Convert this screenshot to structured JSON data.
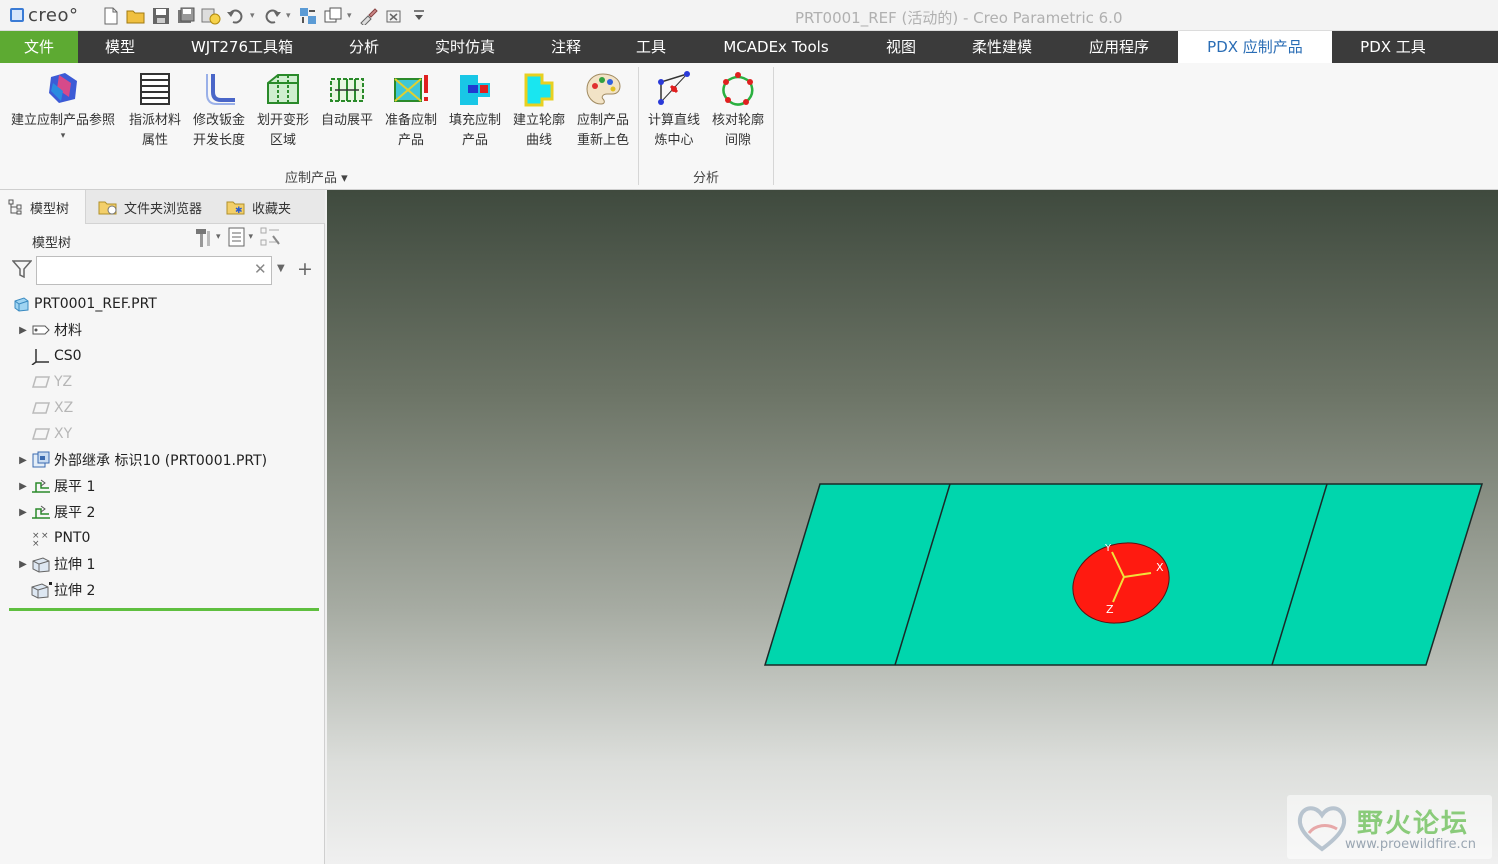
{
  "app": {
    "logo_text": "creo°",
    "window_title": "PRT0001_REF (活动的) - Creo Parametric 6.0"
  },
  "quick_access": [
    "new-icon",
    "open-icon",
    "save-icon",
    "save-copy-icon",
    "regenerate-icon",
    "undo-icon",
    "redo-icon",
    "switch-window-icon",
    "windows-icon",
    "close-window-icon",
    "customize-icon"
  ],
  "tabs": [
    {
      "label": "文件"
    },
    {
      "label": "模型"
    },
    {
      "label": "WJT276工具箱"
    },
    {
      "label": "分析"
    },
    {
      "label": "实时仿真"
    },
    {
      "label": "注释"
    },
    {
      "label": "工具"
    },
    {
      "label": "MCADEx Tools"
    },
    {
      "label": "视图"
    },
    {
      "label": "柔性建模"
    },
    {
      "label": "应用程序"
    },
    {
      "label": "PDX 应制产品"
    },
    {
      "label": "PDX 工具"
    }
  ],
  "ribbon": {
    "groups": [
      {
        "label": "应制产品 ▾"
      },
      {
        "label": "分析"
      }
    ],
    "buttons": [
      {
        "line1": "建立应制产品参照",
        "line2": ""
      },
      {
        "line1": "指派材料",
        "line2": "属性"
      },
      {
        "line1": "修改钣金",
        "line2": "开发长度"
      },
      {
        "line1": "划开变形",
        "line2": "区域"
      },
      {
        "line1": "自动展平",
        "line2": ""
      },
      {
        "line1": "准备应制",
        "line2": "产品"
      },
      {
        "line1": "填充应制",
        "line2": "产品"
      },
      {
        "line1": "建立轮廓",
        "line2": "曲线"
      },
      {
        "line1": "应制产品",
        "line2": "重新上色"
      },
      {
        "line1": "计算直线",
        "line2": "炼中心"
      },
      {
        "line1": "核对轮廓",
        "line2": "间隙"
      }
    ]
  },
  "panel": {
    "tabs": [
      {
        "label": "模型树"
      },
      {
        "label": "文件夹浏览器"
      },
      {
        "label": "收藏夹"
      }
    ],
    "tree_header": "模型树",
    "search": {
      "value": "",
      "placeholder": ""
    },
    "tree": [
      {
        "label": "PRT0001_REF.PRT"
      },
      {
        "label": "材料"
      },
      {
        "label": "CS0"
      },
      {
        "label": "YZ"
      },
      {
        "label": "XZ"
      },
      {
        "label": "XY"
      },
      {
        "label": "外部继承 标识10 (PRT0001.PRT)"
      },
      {
        "label": "展平 1"
      },
      {
        "label": "展平 2"
      },
      {
        "label": "PNT0"
      },
      {
        "label": "拉伸 1"
      },
      {
        "label": "拉伸 2"
      }
    ]
  },
  "viewport": {
    "axes": {
      "x": "X",
      "y": "Y",
      "z": "Z"
    },
    "sheet_color": "#00d6ad",
    "disc_color": "#ff1a10"
  },
  "watermark": {
    "title": "野火论坛",
    "url": "www.proewildfire.cn"
  }
}
